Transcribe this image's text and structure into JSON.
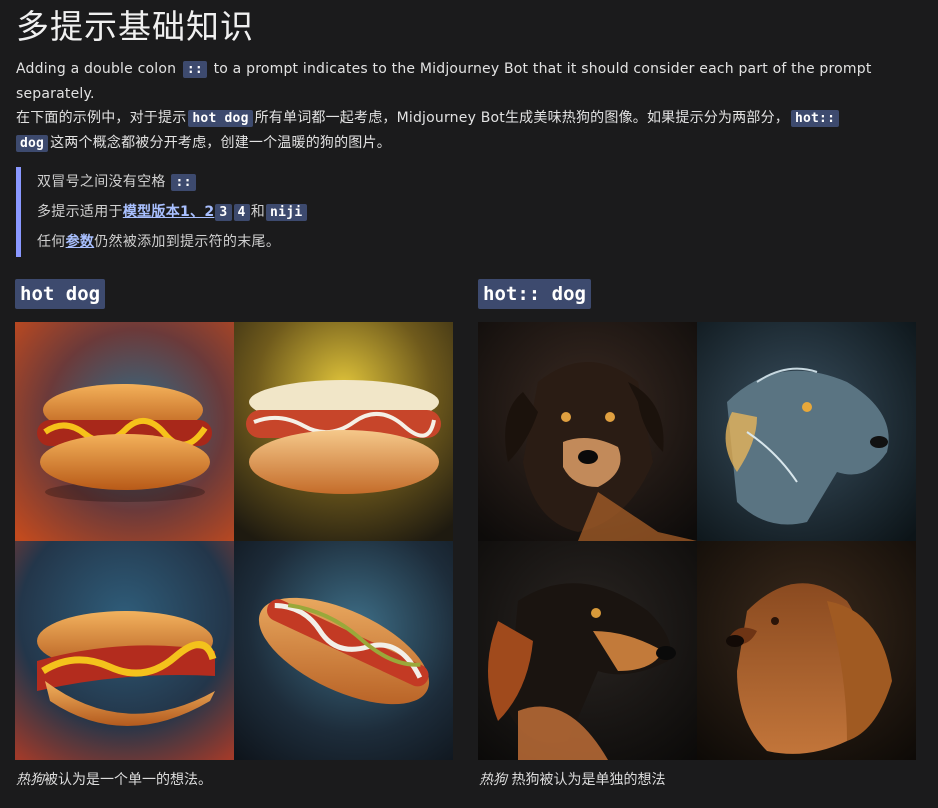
{
  "title": "多提示基础知识",
  "intro": {
    "para1_before": "Adding a double colon",
    "para1_code": "::",
    "para1_after": "to a prompt indicates to the Midjourney Bot that it should consider each part of the prompt separately.",
    "para2_before": "在下面的示例中，对于提示",
    "para2_code1": "hot dog",
    "para2_mid": "所有单词都一起考虑，Midjourney Bot生成美味热狗的图像。如果提示分为两部分，",
    "para2_code2": "hot::",
    "para2_code3": "dog",
    "para2_after": "这两个概念都被分开考虑，创建一个温暖的狗的图片。"
  },
  "callout": {
    "item1_text": "双冒号之间没有空格",
    "item1_code": "::",
    "item2_before": "多提示适用于",
    "item2_link": "模型版本1、2",
    "item2_code1": "3",
    "item2_code2": "4",
    "item2_mid": "和",
    "item2_code3": "niji",
    "item3_before": "任何",
    "item3_link": "参数",
    "item3_after": "仍然被添加到提示符的末尾。"
  },
  "left": {
    "label": "hot dog",
    "caption_em": "热狗",
    "caption_rest": "被认为是一个单一的想法。"
  },
  "right": {
    "label": "hot:: dog",
    "caption_em": "热狗",
    "caption_rest": " 热狗被认为是单独的想法"
  },
  "colors": {
    "background": "#1b1b1c",
    "code_bg": "#3d4a6e",
    "callout_bar": "#8a98ff",
    "link": "#a9c0ff"
  }
}
